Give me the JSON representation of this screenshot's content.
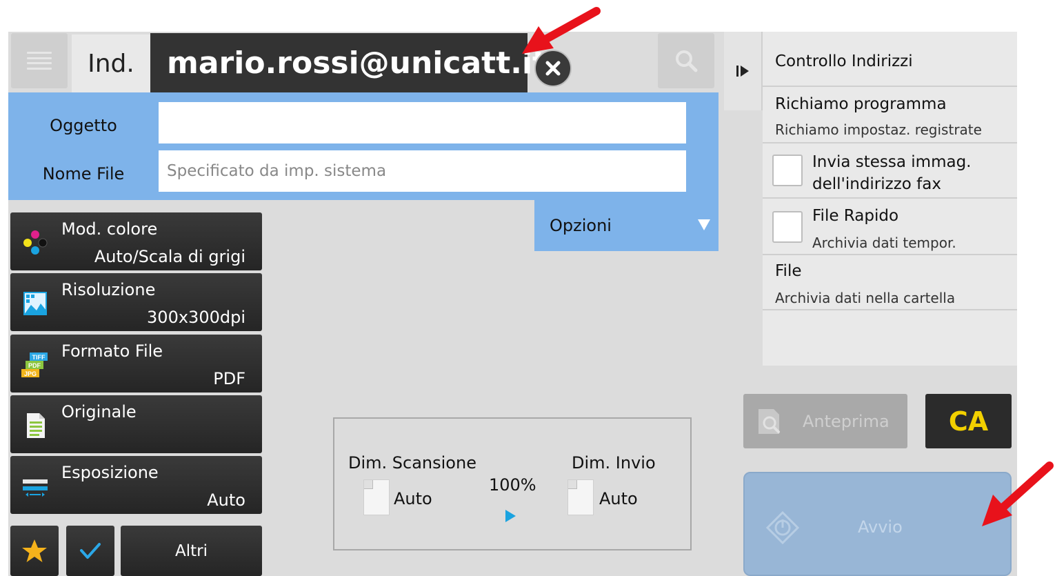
{
  "header": {
    "address_label": "Ind.",
    "address_value": "mario.rossi@unicatt.it"
  },
  "form": {
    "subject_label": "Oggetto",
    "subject_value": "",
    "filename_label": "Nome File",
    "filename_placeholder": "Specificato da imp. sistema",
    "options_label": "Opzioni"
  },
  "settings": [
    {
      "title": "Mod. colore",
      "value": "Auto/Scala di grigi",
      "icon": "color-mode-icon"
    },
    {
      "title": "Risoluzione",
      "value": "300x300dpi",
      "icon": "resolution-icon"
    },
    {
      "title": "Formato File",
      "value": "PDF",
      "icon": "file-format-icon",
      "icon_text": [
        "TIFF",
        "PDF",
        "JPG"
      ]
    },
    {
      "title": "Originale",
      "value": "",
      "icon": "original-icon"
    },
    {
      "title": "Esposizione",
      "value": "Auto",
      "icon": "exposure-icon"
    }
  ],
  "bottom_buttons": {
    "others_label": "Altri"
  },
  "scan_info": {
    "scan_size_label": "Dim. Scansione",
    "scan_size_value": "Auto",
    "ratio": "100%",
    "send_size_label": "Dim. Invio",
    "send_size_value": "Auto"
  },
  "right_panel": {
    "items": [
      {
        "title": "Controllo Indirizzi",
        "subtitle": ""
      },
      {
        "title": "Richiamo programma",
        "subtitle": "Richiamo impostaz. registrate"
      },
      {
        "title": "Invia stessa immag.",
        "subtitle": "dell'indirizzo fax",
        "checkbox": true,
        "checked": false
      },
      {
        "title": "File Rapido",
        "subtitle": "Archivia dati tempor.",
        "checkbox": true,
        "checked": false
      },
      {
        "title": "File",
        "subtitle": "Archivia dati nella cartella"
      }
    ]
  },
  "actions": {
    "preview_label": "Anteprima",
    "clear_all_label": "CA",
    "start_label": "Avvio"
  },
  "colors": {
    "accent_blue": "#7eb3ea",
    "dark_button": "#2b2b2b",
    "ca_yellow": "#f2d000",
    "annotation_red": "#e8121b"
  }
}
